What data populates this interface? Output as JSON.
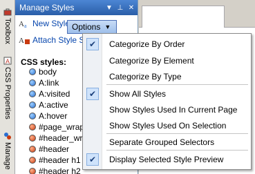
{
  "side_tabs": {
    "toolbox": "Toolbox",
    "css_properties": "CSS Properties",
    "manage": "Manage"
  },
  "panel": {
    "title": "Manage Styles",
    "new_style": "New Style...",
    "attach_style": "Attach Style S",
    "options_label": "Options",
    "css_styles_label": "CSS styles:"
  },
  "styles": [
    {
      "name": "body",
      "kind": "blue"
    },
    {
      "name": "A:link",
      "kind": "blue"
    },
    {
      "name": "A:visited",
      "kind": "blue"
    },
    {
      "name": "A:active",
      "kind": "blue"
    },
    {
      "name": "A:hover",
      "kind": "blue"
    },
    {
      "name": "#page_wrap",
      "kind": "red"
    },
    {
      "name": "#header_wr",
      "kind": "red"
    },
    {
      "name": "#header",
      "kind": "red"
    },
    {
      "name": "#header h1",
      "kind": "red"
    },
    {
      "name": "#header h2",
      "kind": "red"
    }
  ],
  "menu": {
    "items": [
      {
        "label": "Categorize By Order",
        "checked": true
      },
      {
        "label": "Categorize By Element",
        "checked": false
      },
      {
        "label": "Categorize By Type",
        "checked": false
      },
      {
        "label": "Show All Styles",
        "checked": true
      },
      {
        "label": "Show Styles Used In Current Page",
        "checked": false
      },
      {
        "label": "Show Styles Used On Selection",
        "checked": false
      },
      {
        "label": "Separate Grouped Selectors",
        "checked": false
      },
      {
        "label": "Display Selected Style Preview",
        "checked": true
      }
    ]
  },
  "colors": {
    "titlebar": "#2a5ea8",
    "check_bg": "#cfe3fb",
    "link": "#0645ad"
  }
}
